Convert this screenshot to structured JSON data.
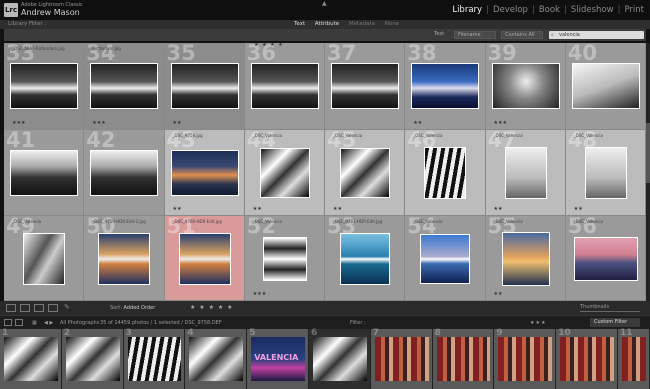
{
  "header": {
    "brand_line1": "Adobe Lightroom Classic",
    "brand_line2": "Andrew Mason",
    "logo_text": "Lrc",
    "modules": [
      "Library",
      "Develop",
      "Book",
      "Slideshow",
      "Print"
    ],
    "active_module": "Library"
  },
  "filter_bar": {
    "title": "Library Filter :",
    "options": [
      "Text",
      "Attribute",
      "Metadata",
      "None"
    ],
    "active_option": "Attribute",
    "text_label": "Text",
    "text_mode": "Filename",
    "contains_label": "Contains All",
    "search_value": "valencia"
  },
  "grid": {
    "rows": [
      {
        "cells": [
          {
            "num": "33",
            "name": "_DSC_5686-Rotterdam.jpg",
            "stars": "★★★",
            "tone": "bw-arch"
          },
          {
            "num": "34",
            "name": "Rotterdam.jpg",
            "stars": "★★★",
            "tone": "bw-arch"
          },
          {
            "num": "35",
            "name": "",
            "stars": "★★",
            "tone": "bw-arch"
          },
          {
            "num": "36",
            "name": "",
            "stars": "",
            "tone": "bw-arch"
          },
          {
            "num": "37",
            "name": "",
            "stars": "",
            "tone": "bw-arch"
          },
          {
            "num": "38",
            "name": "",
            "stars": "★★",
            "tone": "blue-arch"
          },
          {
            "num": "39",
            "name": "",
            "stars": "★★★",
            "tone": "bw-ruin"
          },
          {
            "num": "40",
            "name": "",
            "stars": "",
            "tone": "bw-lamp"
          }
        ]
      },
      {
        "cells": [
          {
            "num": "41",
            "name": "",
            "stars": "",
            "tone": "bw-city"
          },
          {
            "num": "42",
            "name": "",
            "stars": "",
            "tone": "bw-city"
          },
          {
            "num": "43",
            "name": "_DSC_9758.jpg",
            "stars": "★★",
            "tone": "sunset-pier"
          },
          {
            "num": "44",
            "name": "_DSC_Valencia",
            "stars": "★★",
            "tone": "bw-abstract"
          },
          {
            "num": "45",
            "name": "_DSC_Valencia",
            "stars": "★★",
            "tone": "bw-abstract"
          },
          {
            "num": "46",
            "name": "_DSC_Valencia",
            "stars": "",
            "tone": "bw-lines"
          },
          {
            "num": "47",
            "name": "_DSC_Valencia",
            "stars": "★★",
            "tone": "bw-person"
          },
          {
            "num": "48",
            "name": "_DSC_Valencia",
            "stars": "★★",
            "tone": "bw-person"
          }
        ]
      },
      {
        "cells": [
          {
            "num": "49",
            "name": "_DSC_Valencia",
            "stars": "",
            "tone": "bw-person2"
          },
          {
            "num": "50",
            "name": "_DSC_9759-HDR-Edit-2.jpg",
            "stars": "",
            "tone": "color-arch"
          },
          {
            "num": "51",
            "name": "_DSC_9760-HDR-Edit.jpg",
            "stars": "",
            "tone": "color-arch"
          },
          {
            "num": "52",
            "name": "_DSC_Valencia",
            "stars": "★★★",
            "tone": "bw-reflect"
          },
          {
            "num": "53",
            "name": "_DSC_9761-HDR-Edit.jpg",
            "stars": "",
            "tone": "cyan-arch"
          },
          {
            "num": "54",
            "name": "_DSC_Valencia",
            "stars": "",
            "tone": "color-arch2"
          },
          {
            "num": "55",
            "name": "_DSC_Valencia",
            "stars": "★★",
            "tone": "sunset-reeds"
          },
          {
            "num": "56",
            "name": "_DSC_Valencia",
            "stars": "",
            "tone": "sunset-lake"
          }
        ]
      }
    ],
    "row_stars": "★ ★ ★ ★"
  },
  "toolbar": {
    "sort_label": "Sort:",
    "sort_value": "Added Order",
    "stars": "★ ★ ★ ★ ★",
    "thumbnails_label": "Thumbnails"
  },
  "filmstrip_bar": {
    "source": "All Photographs",
    "count": "35 of 14459 photos / 1 selected / DSC_9758.DEF",
    "filter_label": "Filter :",
    "custom_filter": "Custom Filter"
  },
  "filmstrip": {
    "cells": [
      {
        "num": "1",
        "tone": "bw-abstract"
      },
      {
        "num": "2",
        "tone": "bw-abstract"
      },
      {
        "num": "3",
        "tone": "bw-lines"
      },
      {
        "num": "4",
        "tone": "bw-abstract"
      },
      {
        "num": "5",
        "tone": "valencia-sign"
      },
      {
        "num": "6",
        "tone": "bw-abstract"
      },
      {
        "num": "7",
        "tone": "market"
      },
      {
        "num": "8",
        "tone": "market"
      },
      {
        "num": "9",
        "tone": "market"
      },
      {
        "num": "10",
        "tone": "market"
      },
      {
        "num": "11",
        "tone": "market"
      }
    ],
    "sign_text": "VALENCIA"
  },
  "colors": {
    "accent_label_red": "#d04040",
    "accent_label_yellow": "#d0c030",
    "accent_label_green": "#40a040",
    "accent_label_blue": "#4060d0",
    "accent_label_purple": "#9040b0"
  }
}
